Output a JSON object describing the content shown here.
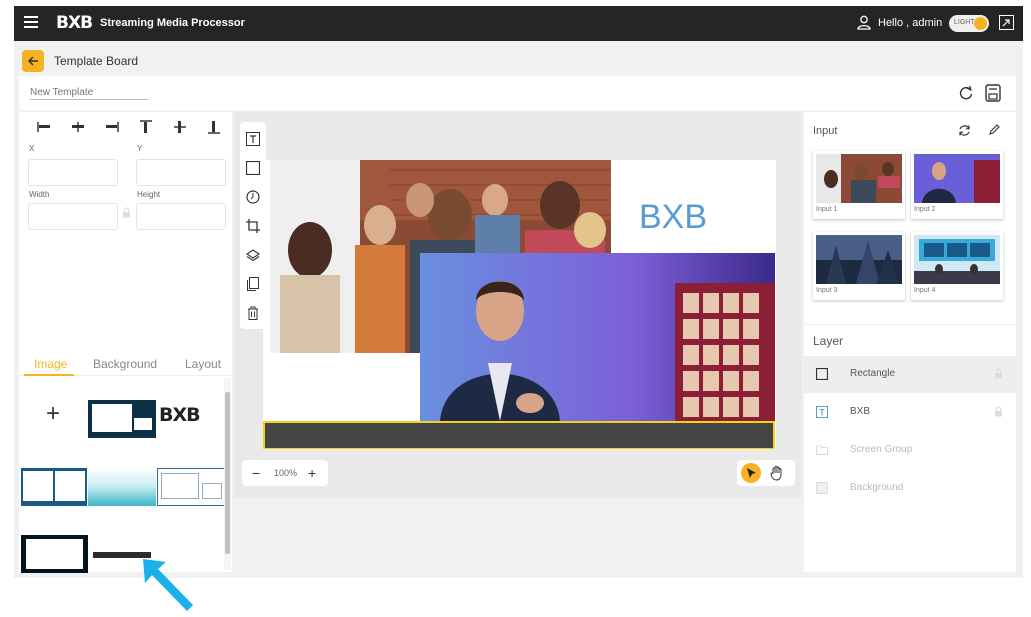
{
  "topbar": {
    "logo": "BXB",
    "app_title": "Streaming Media Processor",
    "greeting": "Hello , admin",
    "theme_toggle_label": "LIGHT",
    "icons": [
      "menu-icon",
      "user-icon",
      "fullscreen-icon"
    ]
  },
  "subheader": {
    "back_icon": "arrow-left-icon",
    "title": "Template Board"
  },
  "namebar": {
    "template_name_placeholder": "New Template",
    "icons": [
      "refresh-icon",
      "save-icon"
    ]
  },
  "properties": {
    "align_icons": [
      "align-left-icon",
      "align-center-h-icon",
      "align-right-icon",
      "align-top-icon",
      "align-middle-v-icon",
      "align-bottom-icon"
    ],
    "x_label": "X",
    "y_label": "Y",
    "width_label": "Width",
    "height_label": "Height",
    "x_value": "",
    "y_value": "",
    "width_value": "",
    "height_value": ""
  },
  "library": {
    "tabs": [
      {
        "label": "Image",
        "active": true
      },
      {
        "label": "Background",
        "active": false
      },
      {
        "label": "Layout",
        "active": false
      }
    ],
    "add_label": "+",
    "logo_thumb_text": "BXB"
  },
  "toolstrip": {
    "tools": [
      "text-tool-icon",
      "rectangle-tool-icon",
      "clock-tool-icon",
      "crop-tool-icon",
      "layers-tool-icon",
      "copy-tool-icon",
      "delete-tool-icon"
    ]
  },
  "stage": {
    "text_layer": "BXB"
  },
  "zoom": {
    "minus": "−",
    "value": "100%",
    "plus": "+"
  },
  "input_panel": {
    "title": "Input",
    "inputs": [
      {
        "label": "Input 1"
      },
      {
        "label": "Input 2"
      },
      {
        "label": "Input 3"
      },
      {
        "label": "Input 4"
      }
    ]
  },
  "layer_panel": {
    "title": "Layer",
    "layers": [
      {
        "name": "Rectangle",
        "icon": "rectangle-icon",
        "selected": true,
        "dim": false
      },
      {
        "name": "BXB",
        "icon": "text-icon",
        "selected": false,
        "dim": false
      },
      {
        "name": "Screen Group",
        "icon": "folder-icon",
        "selected": false,
        "dim": true
      },
      {
        "name": "Background",
        "icon": "image-icon",
        "selected": false,
        "dim": true
      }
    ]
  },
  "colors": {
    "accent": "#f5b324",
    "topbar": "#252525",
    "text_layer": "#5b9bd5",
    "selection": "#f2d31b",
    "arrow": "#1ab0ea"
  }
}
